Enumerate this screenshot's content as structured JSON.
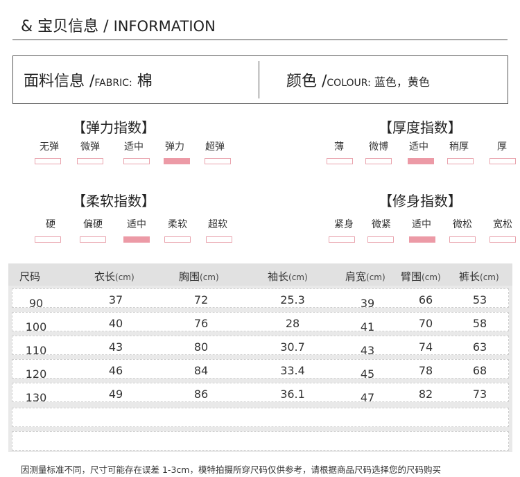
{
  "header": {
    "prefix": "& 宝贝信息",
    "separator": " / ",
    "title_en": "INFORMATION"
  },
  "info": {
    "fabric": {
      "label_cn": "面料信息 /",
      "label_en": "FABRIC:",
      "value": " 棉"
    },
    "colour": {
      "label_cn": "颜色 /",
      "label_en": "COLOUR:",
      "value": " 蓝色，黄色"
    }
  },
  "indices": [
    {
      "title": "【弹力指数】",
      "options": [
        "无弹",
        "微弹",
        "适中",
        "弹力",
        "超弹"
      ],
      "selected": 3
    },
    {
      "title": "【厚度指数】",
      "options": [
        "薄",
        "微博",
        "适中",
        "稍厚",
        "厚"
      ],
      "selected": 2
    },
    {
      "title": "【柔软指数】",
      "options": [
        "硬",
        "偏硬",
        "适中",
        "柔软",
        "超软"
      ],
      "selected": 2
    },
    {
      "title": "【修身指数】",
      "options": [
        "紧身",
        "微紧",
        "适中",
        "微松",
        "宽松"
      ],
      "selected": 2
    }
  ],
  "size_table": {
    "headers": [
      {
        "label": "尺码",
        "unit": ""
      },
      {
        "label": "衣长",
        "unit": "(cm)"
      },
      {
        "label": "胸围",
        "unit": "(cm)"
      },
      {
        "label": "袖长",
        "unit": "(cm)"
      },
      {
        "label": "肩宽",
        "unit": "(cm)"
      },
      {
        "label": "臂围",
        "unit": "(cm)"
      },
      {
        "label": "裤长",
        "unit": "(cm)"
      }
    ],
    "rows": [
      [
        "90",
        "37",
        "72",
        "25.3",
        "39",
        "66",
        "53"
      ],
      [
        "100",
        "40",
        "76",
        "28",
        "41",
        "70",
        "58"
      ],
      [
        "110",
        "43",
        "80",
        "30.7",
        "43",
        "74",
        "63"
      ],
      [
        "120",
        "46",
        "84",
        "33.4",
        "45",
        "78",
        "68"
      ],
      [
        "130",
        "49",
        "86",
        "36.1",
        "47",
        "82",
        "73"
      ]
    ]
  },
  "note": "因测量标准不同，尺寸可能存在误差 1-3cm，模特拍摄所穿尺码仅供参考，请根据商品尺码选择您的尺码购买"
}
